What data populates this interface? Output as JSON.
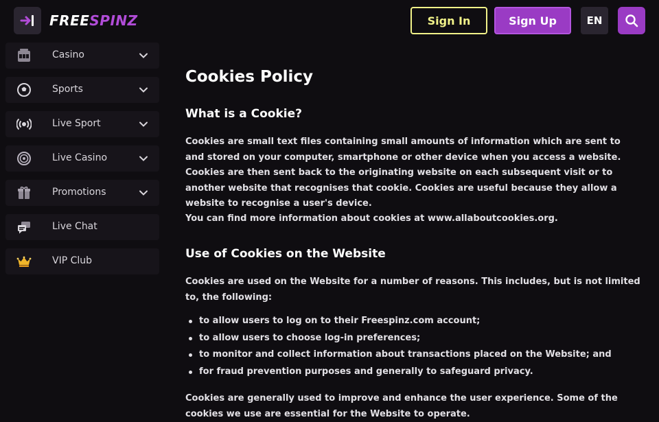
{
  "header": {
    "logo_free": "FREE",
    "logo_spinz": "SPINZ",
    "sign_in": "Sign In",
    "sign_up": "Sign Up",
    "language": "EN",
    "icons": {
      "menu_toggle": "collapse-sidebar-icon",
      "search": "search-icon"
    }
  },
  "sidebar": {
    "items": [
      {
        "label": "Casino",
        "icon": "slot-machine-icon",
        "expandable": true
      },
      {
        "label": "Sports",
        "icon": "soccer-ball-icon",
        "expandable": true
      },
      {
        "label": "Live Sport",
        "icon": "broadcast-icon",
        "expandable": true
      },
      {
        "label": "Live Casino",
        "icon": "roulette-icon",
        "expandable": true
      },
      {
        "label": "Promotions",
        "icon": "gift-icon",
        "expandable": true
      },
      {
        "label": "Live Chat",
        "icon": "chat-icon",
        "expandable": false
      },
      {
        "label": "VIP Club",
        "icon": "crown-icon",
        "expandable": false
      }
    ]
  },
  "content": {
    "title": "Cookies Policy",
    "section1_heading": "What is a Cookie?",
    "section1_para1": "Cookies are small text files containing small amounts of information which are sent to and stored on your computer, smartphone or other device when you access a website. Cookies are then sent back to the originating website on each subsequent visit or to another website that recognises that cookie. Cookies are useful because they allow a website to recognise a user's device.",
    "section1_para2": "You can find more information about cookies at www.allaboutcookies.org.",
    "section2_heading": "Use of Cookies on the Website",
    "section2_para1": "Cookies are used on the Website for a number of reasons. This includes, but is not limited to, the following:",
    "bullets": [
      "to allow users to log on to their Freespinz.com account;",
      "to allow users to choose log-in preferences;",
      "to monitor and collect information about transactions placed on the Website; and",
      "for fraud prevention purposes and generally to safeguard privacy."
    ],
    "section2_para2": "Cookies are generally used to improve and enhance the user experience. Some of the cookies we use are essential for the Website to operate."
  },
  "colors": {
    "background": "#0f0d11",
    "sidebar_item": "#17141a",
    "accent_purple": "#9a3bc4",
    "accent_yellow": "#f1f289"
  }
}
